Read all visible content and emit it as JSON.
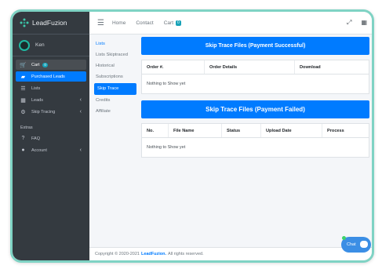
{
  "brand": {
    "name": "LeadFuzion"
  },
  "user": {
    "name": "Ken"
  },
  "sidebar": {
    "items": [
      {
        "label": "Cart",
        "icon": "cart-icon",
        "badge": "0"
      },
      {
        "label": "Purchased Leads",
        "icon": "folder-icon"
      },
      {
        "label": "Lists",
        "icon": "list-icon"
      },
      {
        "label": "Leads",
        "icon": "grid-icon"
      },
      {
        "label": "Skip Tracing",
        "icon": "gear-icon"
      }
    ],
    "extras_header": "Extras",
    "extras": [
      {
        "label": "FAQ",
        "icon": "question-icon"
      },
      {
        "label": "Account",
        "icon": "user-icon"
      }
    ]
  },
  "topbar": {
    "home": "Home",
    "contact": "Contact",
    "cart": "Cart",
    "cart_badge": "0"
  },
  "subnav": {
    "items": [
      "Lists",
      "Lists Skiptraced",
      "Historical",
      "Subscriptions",
      "Skip Trace",
      "Credits",
      "Affiliate"
    ],
    "active": "Skip Trace"
  },
  "success": {
    "title": "Skip Trace Files (Payment Successful)",
    "columns": [
      "Order #.",
      "Order Details",
      "Download"
    ],
    "empty": "Nothing to Show yet"
  },
  "failed": {
    "title": "Skip Trace Files (Payment Failed)",
    "columns": [
      "No.",
      "File Name",
      "Status",
      "Upload Date",
      "Process"
    ],
    "empty": "Nothing to Show yet"
  },
  "footer": {
    "prefix": "Copyright © 2020-2021",
    "brand": "LeadFuzion.",
    "suffix": "All rights reserved."
  },
  "chat": {
    "label": "Chat"
  },
  "colors": {
    "accent": "#007bff",
    "sidebar": "#343a40",
    "frame": "#7fd3c4",
    "badge": "#17a2b8"
  }
}
